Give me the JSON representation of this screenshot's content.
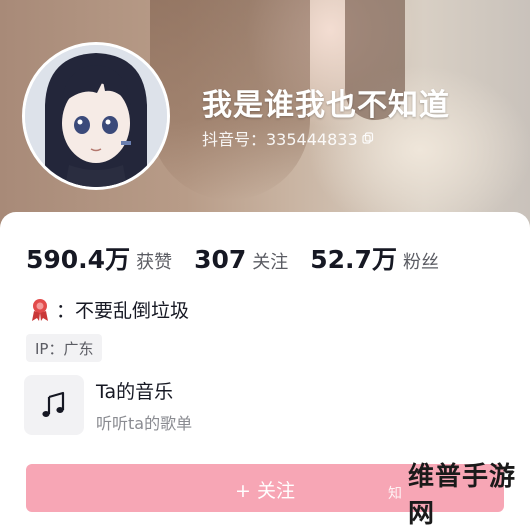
{
  "profile": {
    "nickname": "我是谁我也不知道",
    "douyin_id": "抖音号：335444833"
  },
  "stats": [
    {
      "value": "590.4万",
      "label": "获赞"
    },
    {
      "value": "307",
      "label": "关注"
    },
    {
      "value": "52.7万",
      "label": "粉丝"
    }
  ],
  "bio": {
    "text": "：不要乱倒垃圾",
    "icon": "ribbon-award-icon"
  },
  "ip_location": "IP：广东",
  "music": {
    "title": "Ta的音乐",
    "subtitle": "听听ta的歌单",
    "icon": "music-note-icon"
  },
  "follow_button": {
    "label": "+ 关注"
  },
  "watermark": {
    "faint_text": "知",
    "text": "维普手游网"
  },
  "colors": {
    "follow_button_bg": "#f7a6b5",
    "bio_icon": "#e24b4b",
    "text_primary": "#161823",
    "text_secondary": "#5b5c63"
  }
}
